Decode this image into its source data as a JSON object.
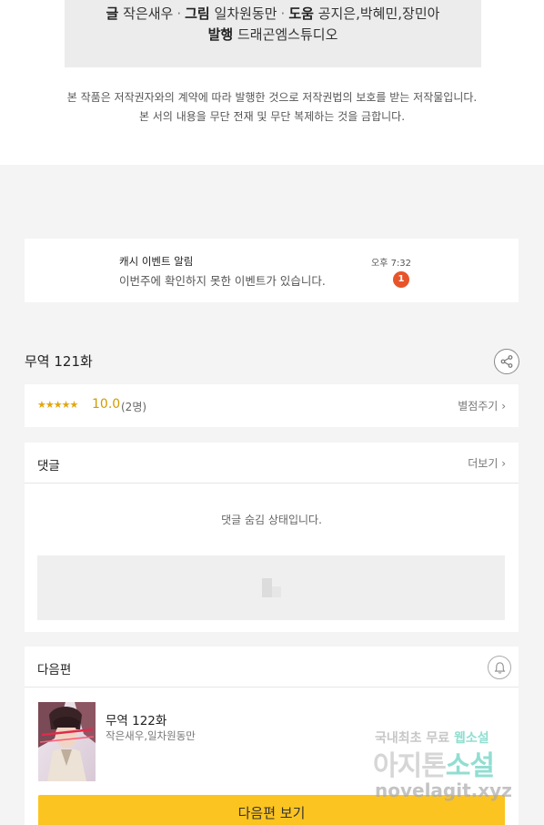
{
  "credits": {
    "writer_label": "글",
    "writer": "작은새우",
    "art_label": "그림",
    "art": "일차원동만",
    "assist_label": "도움",
    "assist": "공지은,박혜민,장민아",
    "publisher_label": "발행",
    "publisher": "드래곤엠스튜디오",
    "separator": "·"
  },
  "copyright": {
    "line1": "본 작품은 저작권자와의 계약에 따라 발행한 것으로 저작권법의 보호를 받는 저작물입니다.",
    "line2": "본 서의 내용을 무단 전재 및 무단 복제하는 것을 금합니다."
  },
  "notification": {
    "title": "캐시 이벤트 알림",
    "message": "이번주에 확인하지 못한 이벤트가 있습니다.",
    "time": "오후 7:32",
    "badge_count": "1"
  },
  "episode": {
    "title": "무역 121화"
  },
  "rating": {
    "stars": "★★★★★",
    "score": "10.0",
    "count": "(2명)",
    "rate_link": "별점주기",
    "star_color": "#e2a60e"
  },
  "comments": {
    "label": "댓글",
    "more": "더보기",
    "hidden_message": "댓글 숨김 상태입니다."
  },
  "next": {
    "label": "다음편",
    "title": "무역 122화",
    "author": "작은새우,일차원동만",
    "button": "다음편 보기",
    "button_color": "#fcc420"
  },
  "watermark": {
    "line1_a": "국내최초 무료 ",
    "line1_b": "웹소설",
    "line2_a": "아지톤",
    "line2_b": "소설",
    "line3": "novelagit.xyz"
  },
  "icons": {
    "chevron": "›",
    "share": "share-icon",
    "bell": "bell-icon",
    "placeholder": "image-placeholder-icon"
  }
}
